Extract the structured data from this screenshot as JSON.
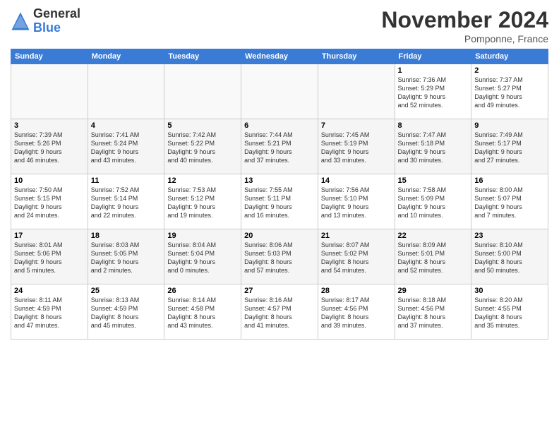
{
  "header": {
    "logo_general": "General",
    "logo_blue": "Blue",
    "month_title": "November 2024",
    "location": "Pomponne, France"
  },
  "weekdays": [
    "Sunday",
    "Monday",
    "Tuesday",
    "Wednesday",
    "Thursday",
    "Friday",
    "Saturday"
  ],
  "weeks": [
    [
      {
        "day": "",
        "info": ""
      },
      {
        "day": "",
        "info": ""
      },
      {
        "day": "",
        "info": ""
      },
      {
        "day": "",
        "info": ""
      },
      {
        "day": "",
        "info": ""
      },
      {
        "day": "1",
        "info": "Sunrise: 7:36 AM\nSunset: 5:29 PM\nDaylight: 9 hours\nand 52 minutes."
      },
      {
        "day": "2",
        "info": "Sunrise: 7:37 AM\nSunset: 5:27 PM\nDaylight: 9 hours\nand 49 minutes."
      }
    ],
    [
      {
        "day": "3",
        "info": "Sunrise: 7:39 AM\nSunset: 5:26 PM\nDaylight: 9 hours\nand 46 minutes."
      },
      {
        "day": "4",
        "info": "Sunrise: 7:41 AM\nSunset: 5:24 PM\nDaylight: 9 hours\nand 43 minutes."
      },
      {
        "day": "5",
        "info": "Sunrise: 7:42 AM\nSunset: 5:22 PM\nDaylight: 9 hours\nand 40 minutes."
      },
      {
        "day": "6",
        "info": "Sunrise: 7:44 AM\nSunset: 5:21 PM\nDaylight: 9 hours\nand 37 minutes."
      },
      {
        "day": "7",
        "info": "Sunrise: 7:45 AM\nSunset: 5:19 PM\nDaylight: 9 hours\nand 33 minutes."
      },
      {
        "day": "8",
        "info": "Sunrise: 7:47 AM\nSunset: 5:18 PM\nDaylight: 9 hours\nand 30 minutes."
      },
      {
        "day": "9",
        "info": "Sunrise: 7:49 AM\nSunset: 5:17 PM\nDaylight: 9 hours\nand 27 minutes."
      }
    ],
    [
      {
        "day": "10",
        "info": "Sunrise: 7:50 AM\nSunset: 5:15 PM\nDaylight: 9 hours\nand 24 minutes."
      },
      {
        "day": "11",
        "info": "Sunrise: 7:52 AM\nSunset: 5:14 PM\nDaylight: 9 hours\nand 22 minutes."
      },
      {
        "day": "12",
        "info": "Sunrise: 7:53 AM\nSunset: 5:12 PM\nDaylight: 9 hours\nand 19 minutes."
      },
      {
        "day": "13",
        "info": "Sunrise: 7:55 AM\nSunset: 5:11 PM\nDaylight: 9 hours\nand 16 minutes."
      },
      {
        "day": "14",
        "info": "Sunrise: 7:56 AM\nSunset: 5:10 PM\nDaylight: 9 hours\nand 13 minutes."
      },
      {
        "day": "15",
        "info": "Sunrise: 7:58 AM\nSunset: 5:09 PM\nDaylight: 9 hours\nand 10 minutes."
      },
      {
        "day": "16",
        "info": "Sunrise: 8:00 AM\nSunset: 5:07 PM\nDaylight: 9 hours\nand 7 minutes."
      }
    ],
    [
      {
        "day": "17",
        "info": "Sunrise: 8:01 AM\nSunset: 5:06 PM\nDaylight: 9 hours\nand 5 minutes."
      },
      {
        "day": "18",
        "info": "Sunrise: 8:03 AM\nSunset: 5:05 PM\nDaylight: 9 hours\nand 2 minutes."
      },
      {
        "day": "19",
        "info": "Sunrise: 8:04 AM\nSunset: 5:04 PM\nDaylight: 9 hours\nand 0 minutes."
      },
      {
        "day": "20",
        "info": "Sunrise: 8:06 AM\nSunset: 5:03 PM\nDaylight: 8 hours\nand 57 minutes."
      },
      {
        "day": "21",
        "info": "Sunrise: 8:07 AM\nSunset: 5:02 PM\nDaylight: 8 hours\nand 54 minutes."
      },
      {
        "day": "22",
        "info": "Sunrise: 8:09 AM\nSunset: 5:01 PM\nDaylight: 8 hours\nand 52 minutes."
      },
      {
        "day": "23",
        "info": "Sunrise: 8:10 AM\nSunset: 5:00 PM\nDaylight: 8 hours\nand 50 minutes."
      }
    ],
    [
      {
        "day": "24",
        "info": "Sunrise: 8:11 AM\nSunset: 4:59 PM\nDaylight: 8 hours\nand 47 minutes."
      },
      {
        "day": "25",
        "info": "Sunrise: 8:13 AM\nSunset: 4:59 PM\nDaylight: 8 hours\nand 45 minutes."
      },
      {
        "day": "26",
        "info": "Sunrise: 8:14 AM\nSunset: 4:58 PM\nDaylight: 8 hours\nand 43 minutes."
      },
      {
        "day": "27",
        "info": "Sunrise: 8:16 AM\nSunset: 4:57 PM\nDaylight: 8 hours\nand 41 minutes."
      },
      {
        "day": "28",
        "info": "Sunrise: 8:17 AM\nSunset: 4:56 PM\nDaylight: 8 hours\nand 39 minutes."
      },
      {
        "day": "29",
        "info": "Sunrise: 8:18 AM\nSunset: 4:56 PM\nDaylight: 8 hours\nand 37 minutes."
      },
      {
        "day": "30",
        "info": "Sunrise: 8:20 AM\nSunset: 4:55 PM\nDaylight: 8 hours\nand 35 minutes."
      }
    ]
  ]
}
